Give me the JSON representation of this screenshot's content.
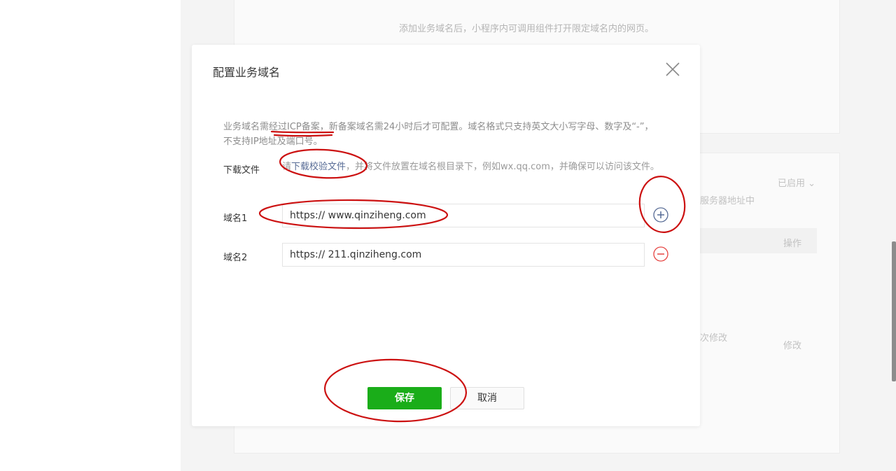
{
  "background": {
    "description": "添加业务域名后，小程序内可调用组件打开限定域名内的网页。",
    "status_dropdown": "已启用",
    "server_note": "服务器地址中",
    "col_action": "操作",
    "modify_note": "次修改",
    "modify_link": "修改"
  },
  "dialog": {
    "title": "配置业务域名",
    "notice_prefix": "业务域名",
    "notice_icp": "需经过ICP备案",
    "notice_rest": "，新备案域名需24小时后才可配置。域名格式只支持英文大小写字母、数字及“-”，不支持IP地址及端口号。",
    "download_label": "下载文件",
    "download_prefix": "请",
    "download_link": "下载校验文件",
    "download_suffix": "，并将文件放置在域名根目录下，例如wx.qq.com，并确保可以访问该文件。",
    "domains": [
      {
        "label": "域名1",
        "value": "https:// www.qinziheng.com"
      },
      {
        "label": "域名2",
        "value": "https:// 211.qinziheng.com"
      }
    ],
    "save_label": "保存",
    "cancel_label": "取消"
  },
  "colors": {
    "accent_green": "#1aad19",
    "link_blue": "#576b95",
    "delete_red": "#e64340",
    "annotation_red": "#cc1111"
  },
  "icons": [
    "close-icon",
    "add-domain-icon",
    "remove-domain-icon"
  ]
}
